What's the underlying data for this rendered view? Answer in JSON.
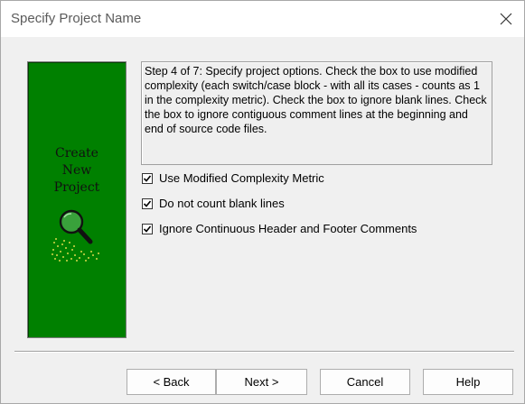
{
  "window": {
    "title": "Specify Project Name"
  },
  "side_panel": {
    "lines": [
      "Create",
      "New",
      "Project"
    ],
    "bg_color": "#008000",
    "icon": "magnifier-icon"
  },
  "description": "Step 4 of 7: Specify project options. Check the box to use modified complexity (each switch/case block - with all its cases - counts as 1 in the complexity metric). Check the box to ignore blank lines. Check the box to ignore contiguous comment lines at the beginning and end of source code files.",
  "options": [
    {
      "label": "Use Modified Complexity Metric",
      "checked": true
    },
    {
      "label": "Do not count blank lines",
      "checked": true
    },
    {
      "label": "Ignore Continuous Header and Footer Comments",
      "checked": true
    }
  ],
  "buttons": {
    "back": "< Back",
    "next": "Next >",
    "cancel": "Cancel",
    "help": "Help"
  }
}
